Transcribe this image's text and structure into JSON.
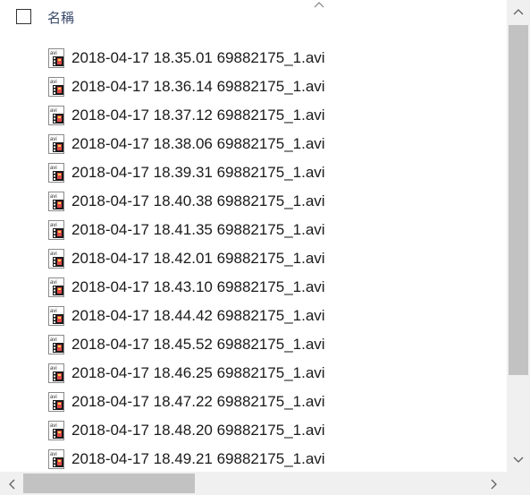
{
  "header": {
    "name_label": "名稱"
  },
  "icons": {
    "file": "avi-video-file-icon",
    "sort": "chevron-up-icon"
  },
  "files": [
    "2018-04-17 18.35.01 69882175_1.avi",
    "2018-04-17 18.36.14 69882175_1.avi",
    "2018-04-17 18.37.12 69882175_1.avi",
    "2018-04-17 18.38.06 69882175_1.avi",
    "2018-04-17 18.39.31 69882175_1.avi",
    "2018-04-17 18.40.38 69882175_1.avi",
    "2018-04-17 18.41.35 69882175_1.avi",
    "2018-04-17 18.42.01 69882175_1.avi",
    "2018-04-17 18.43.10 69882175_1.avi",
    "2018-04-17 18.44.42 69882175_1.avi",
    "2018-04-17 18.45.52 69882175_1.avi",
    "2018-04-17 18.46.25 69882175_1.avi",
    "2018-04-17 18.47.22 69882175_1.avi",
    "2018-04-17 18.48.20 69882175_1.avi",
    "2018-04-17 18.49.21 69882175_1.avi"
  ]
}
